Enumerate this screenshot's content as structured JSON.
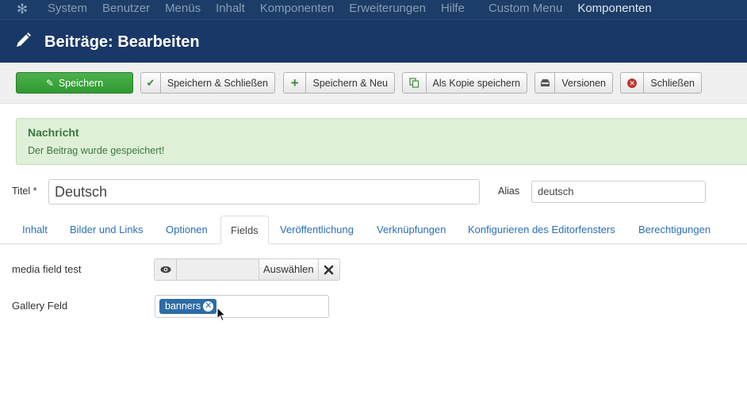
{
  "navbar": {
    "logo_icon": "joomla-logo-icon",
    "items": [
      "System",
      "Benutzer",
      "Menüs",
      "Inhalt",
      "Komponenten",
      "Erweiterungen",
      "Hilfe"
    ],
    "custom_menu": "Custom Menu",
    "active_menu": "Komponenten"
  },
  "header": {
    "title": "Beiträge: Bearbeiten",
    "icon": "pencil-icon"
  },
  "toolbar": {
    "save_label": "Speichern",
    "save_close_label": "Speichern & Schließen",
    "save_new_label": "Speichern & Neu",
    "save_copy_label": "Als Kopie speichern",
    "versions_label": "Versionen",
    "close_label": "Schließen"
  },
  "message": {
    "heading": "Nachricht",
    "text": "Der Beitrag wurde gespeichert!",
    "color": "#dff0d8"
  },
  "form": {
    "title_label": "Titel *",
    "title_value": "Deutsch",
    "alias_label": "Alias",
    "alias_value": "deutsch"
  },
  "tabs": [
    "Inhalt",
    "Bilder und Links",
    "Optionen",
    "Fields",
    "Veröffentlichung",
    "Verknüpfungen",
    "Konfigurieren des Editorfensters",
    "Berechtigungen"
  ],
  "active_tab": "Fields",
  "fields": {
    "media_label": "media field test",
    "media_select_label": "Auswählen",
    "gallery_label": "Gallery Feld",
    "gallery_tag": "banners"
  },
  "colors": {
    "navbar": "#1c3d67",
    "primary_button": "#3fa43f",
    "link": "#2a6fb6",
    "tag": "#2d6ca5"
  }
}
